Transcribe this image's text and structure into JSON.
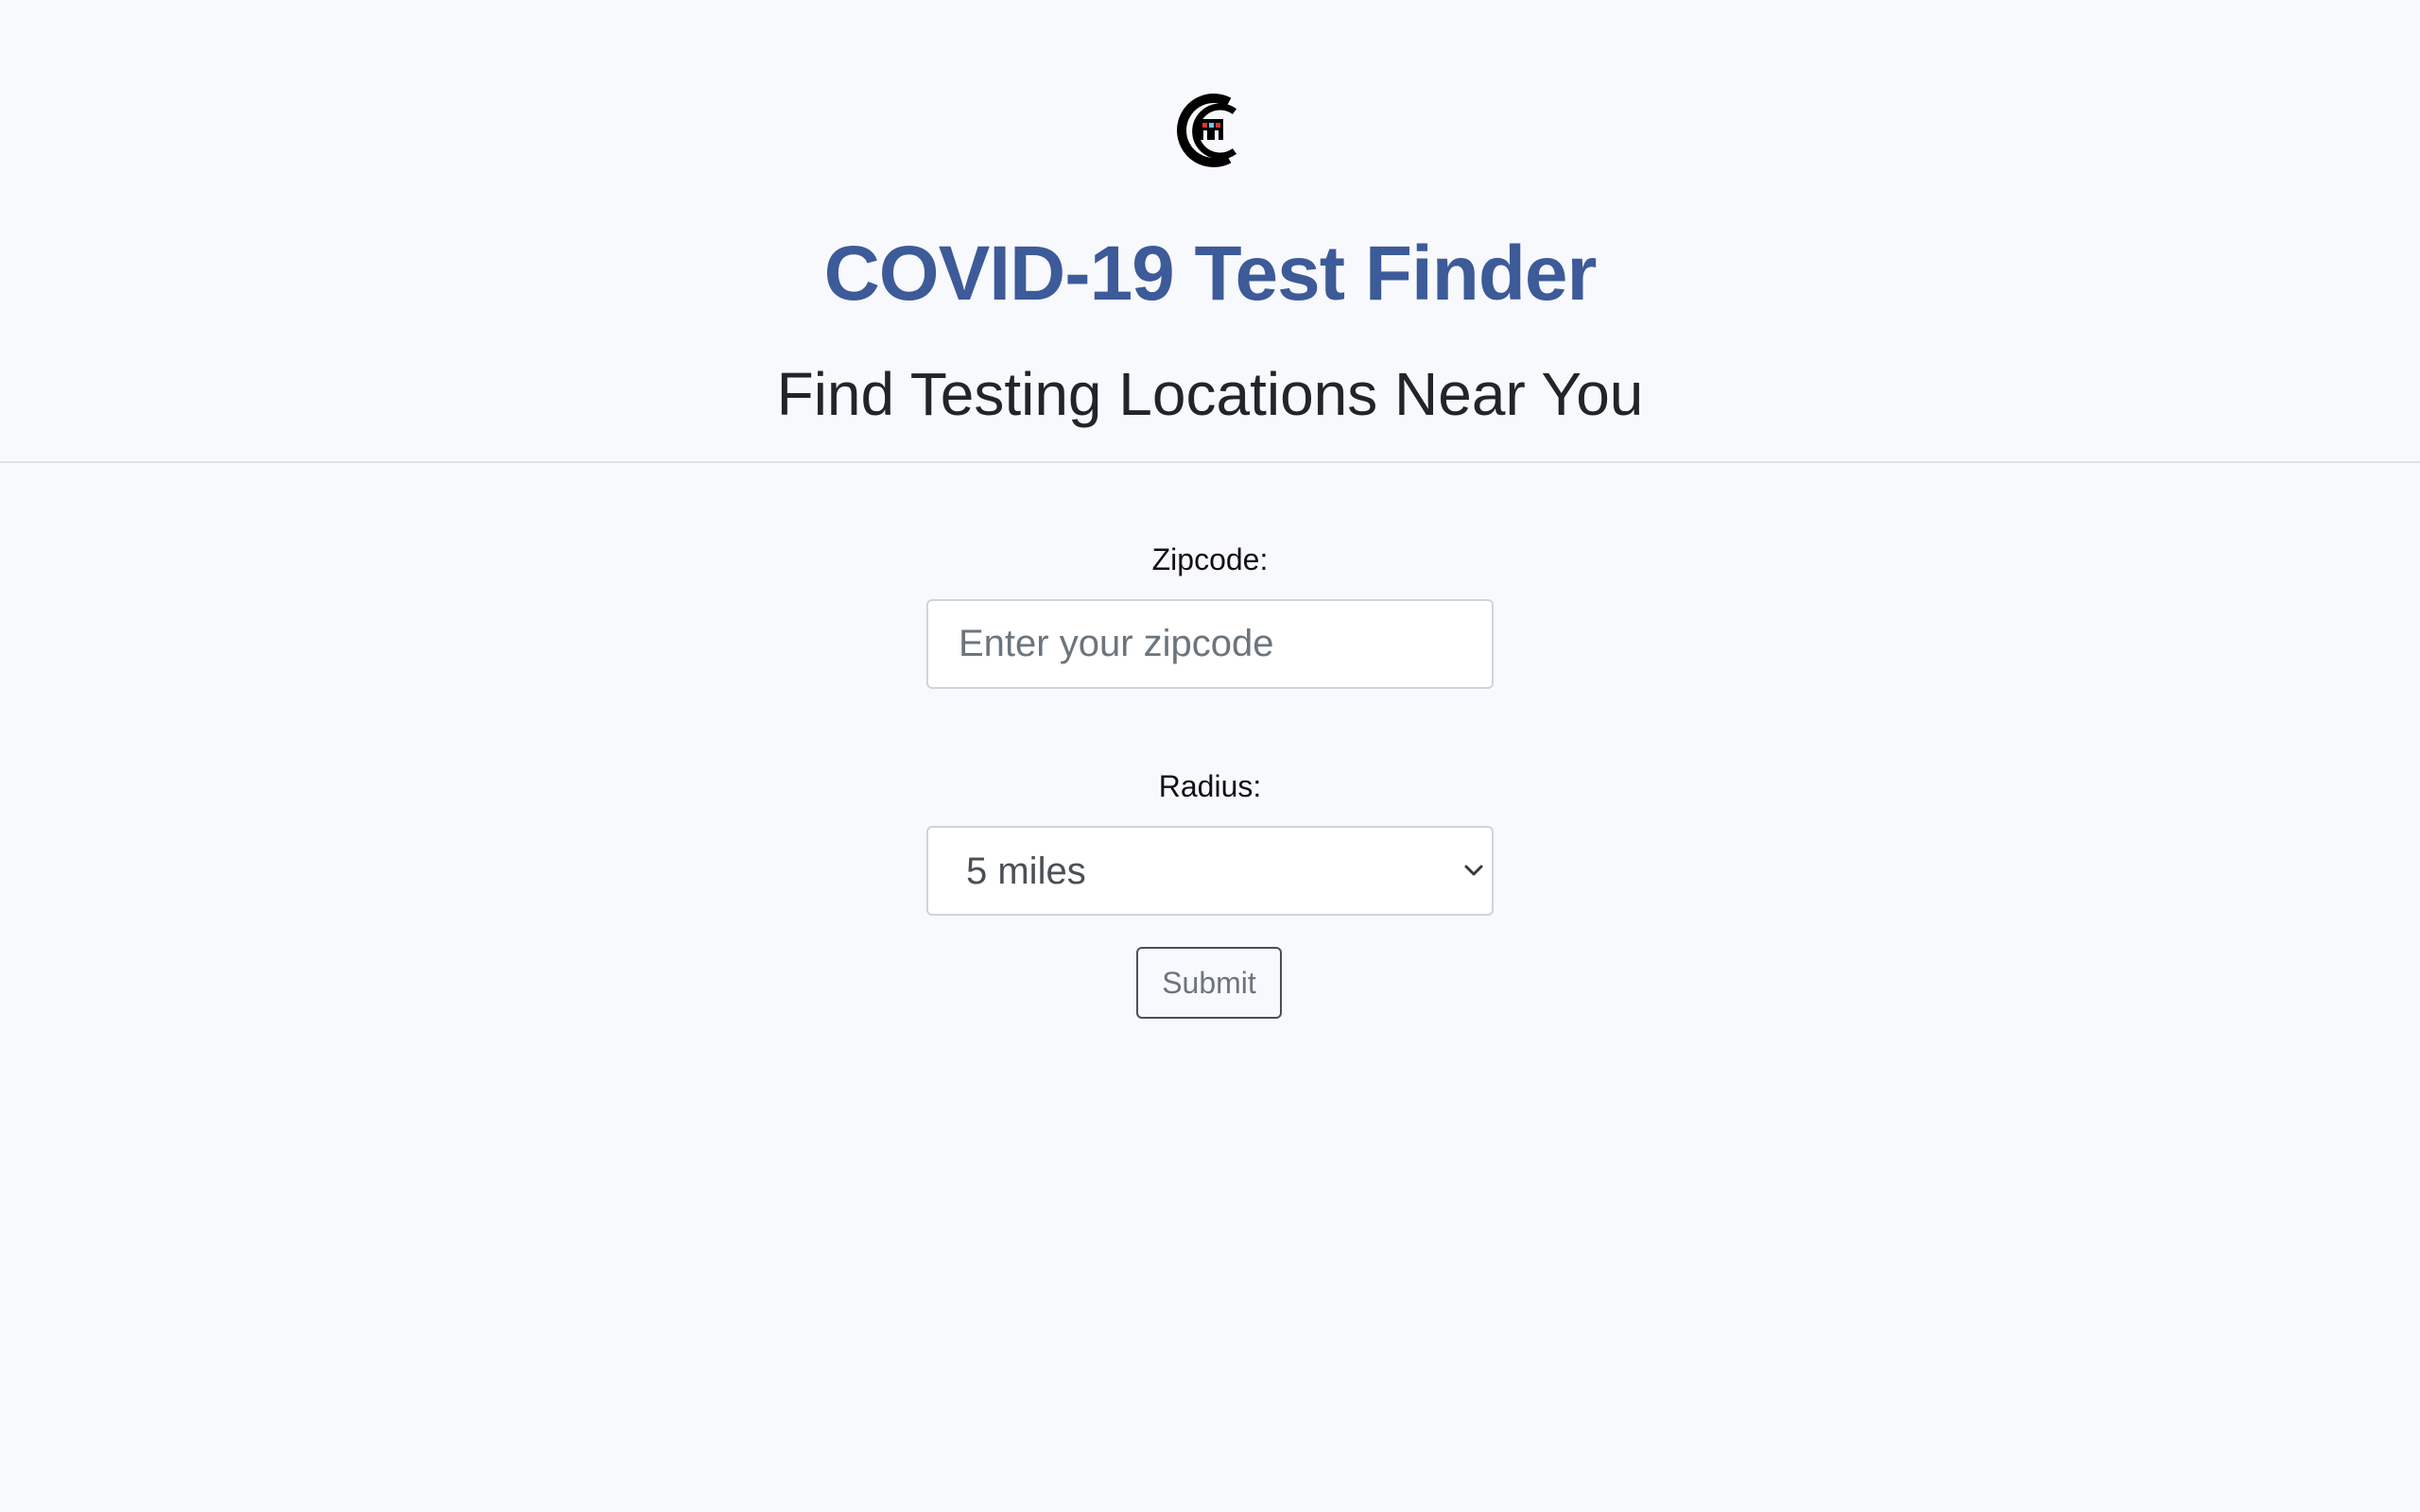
{
  "header": {
    "logo_icon": "cc-logo-icon",
    "title": "COVID-19 Test Finder",
    "subtitle": "Find Testing Locations Near You"
  },
  "form": {
    "zipcode_label": "Zipcode:",
    "zipcode_placeholder": "Enter your zipcode",
    "zipcode_value": "",
    "radius_label": "Radius:",
    "radius_selected": "5 miles",
    "submit_label": "Submit"
  },
  "colors": {
    "background": "#f8f9fd",
    "title": "#3d5a99",
    "text": "#212529",
    "border": "#ced4da"
  }
}
